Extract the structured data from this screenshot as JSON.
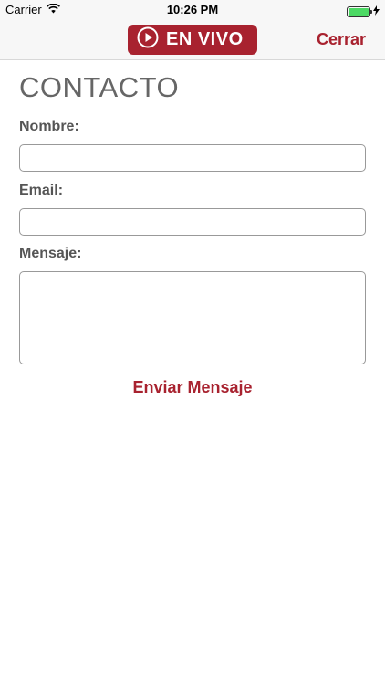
{
  "status_bar": {
    "carrier": "Carrier",
    "time": "10:26 PM"
  },
  "nav": {
    "live_label": "EN VIVO",
    "close_label": "Cerrar"
  },
  "page": {
    "title": "CONTACTO"
  },
  "form": {
    "name_label": "Nombre:",
    "name_value": "",
    "email_label": "Email:",
    "email_value": "",
    "message_label": "Mensaje:",
    "message_value": "",
    "submit_label": "Enviar Mensaje"
  },
  "theme": {
    "accent": "#a8222f",
    "battery": "#4cd964",
    "bar_bg": "#f7f7f7"
  },
  "icons": {
    "live": "play-circle-icon",
    "signal": "wifi-icon",
    "battery": "battery-icon",
    "charging": "bolt-icon"
  }
}
